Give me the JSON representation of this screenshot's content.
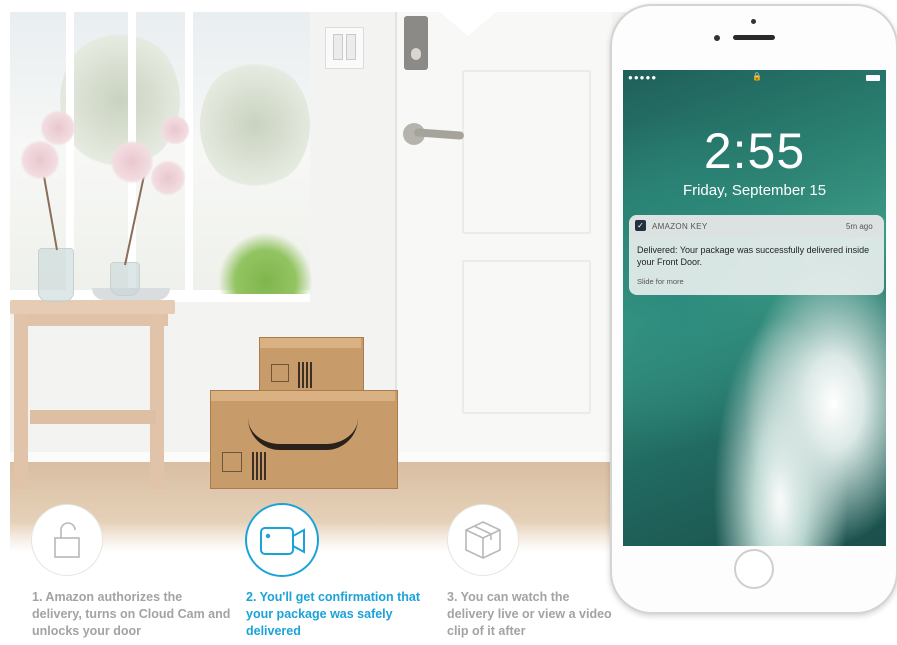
{
  "phone": {
    "time": "2:55",
    "date": "Friday, September 15",
    "status_signal": "●●●●● ",
    "notification": {
      "app_name": "AMAZON KEY",
      "time": "5m ago",
      "message": "Delivered: Your package was successfully delivered inside your Front Door.",
      "action_hint": "Slide for more"
    }
  },
  "steps": [
    {
      "label": "1. Amazon authorizes the delivery, turns on Cloud Cam and unlocks your door",
      "icon": "unlock-icon",
      "active": false
    },
    {
      "label": "2. You'll get confirmation that your package was safely delivered",
      "icon": "video-camera-icon",
      "active": true
    },
    {
      "label": "3. You can watch the delivery live or view a video clip of it after",
      "icon": "package-icon",
      "active": false
    }
  ],
  "colors": {
    "accent": "#1aa3d9",
    "inactive_text": "#a3a3a3"
  }
}
